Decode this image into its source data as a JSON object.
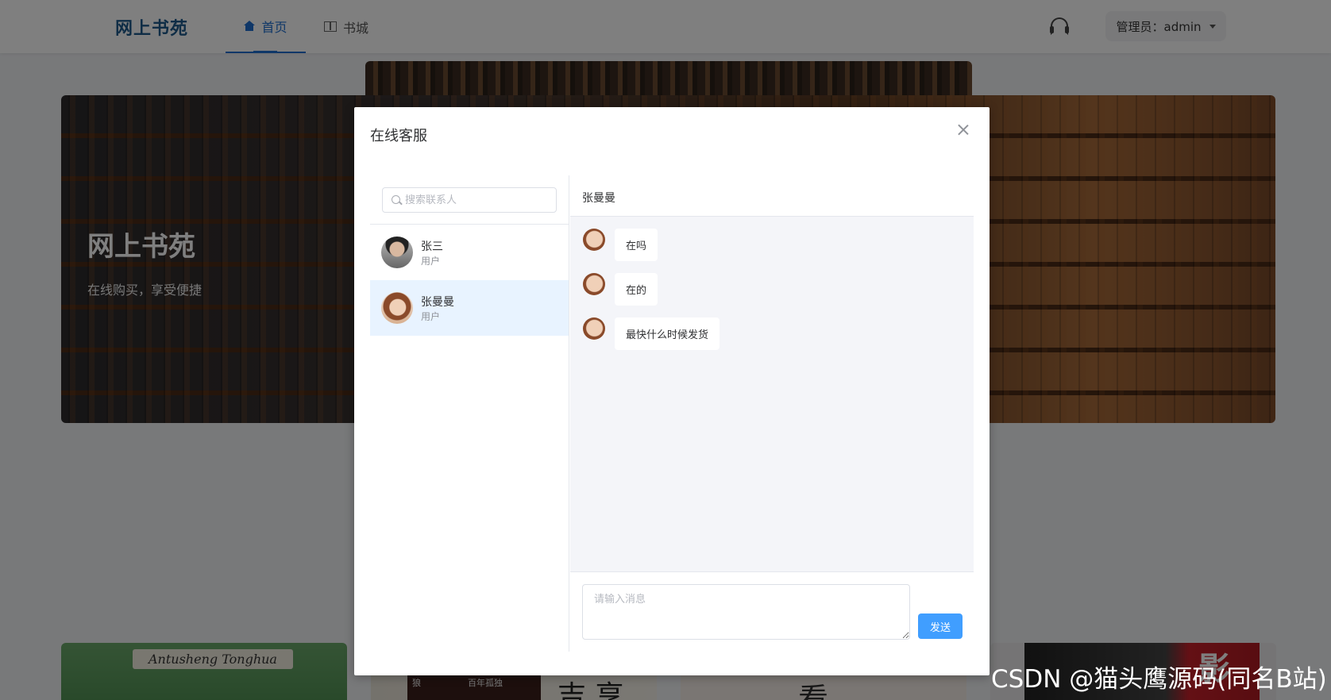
{
  "header": {
    "logo": "网上书苑",
    "nav": [
      {
        "label": "首页",
        "icon": "home-icon",
        "active": true
      },
      {
        "label": "书城",
        "icon": "book-icon",
        "active": false
      }
    ],
    "service_icon": "headset-icon",
    "admin_label": "管理员：admin"
  },
  "banner": {
    "title": "网上书苑",
    "subtitle": "在线购买，享受便捷"
  },
  "cards": [
    {
      "text": "Antusheng  Tonghua"
    },
    {
      "text": "吉 享",
      "small": "百年孤独",
      "small2": "狼"
    },
    {
      "text": "看"
    },
    {
      "text": "影"
    }
  ],
  "dialog": {
    "title": "在线客服",
    "search_placeholder": "搜索联系人",
    "contacts": [
      {
        "name": "张三",
        "role": "用户",
        "selected": false
      },
      {
        "name": "张曼曼",
        "role": "用户",
        "selected": true
      }
    ],
    "chat_title": "张曼曼",
    "messages": [
      {
        "text": "在吗"
      },
      {
        "text": "在的"
      },
      {
        "text": "最快什么时候发货"
      }
    ],
    "input_placeholder": "请输入消息",
    "send_label": "发送"
  },
  "colors": {
    "primary": "#409eff",
    "brand": "#1f5a8c",
    "selected_row": "#e8f3ff",
    "chat_bg": "#f4f5f9"
  },
  "watermark": "CSDN @猫头鹰源码(同名B站)"
}
